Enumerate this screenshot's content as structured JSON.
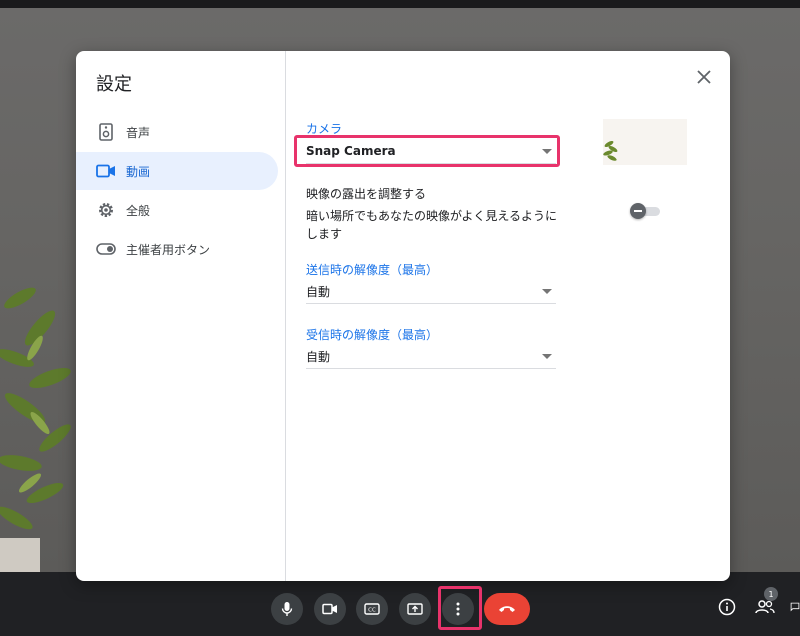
{
  "dialog": {
    "title": "設定",
    "nav": [
      {
        "label": "音声",
        "icon": "speaker-icon"
      },
      {
        "label": "動画",
        "icon": "videocam-icon"
      },
      {
        "label": "全般",
        "icon": "gear-icon"
      },
      {
        "label": "主催者用ボタン",
        "icon": "toggle-icon"
      }
    ],
    "active_nav": "動画",
    "camera": {
      "label": "カメラ",
      "value": "Snap Camera"
    },
    "exposure": {
      "title": "映像の露出を調整する",
      "description": "暗い場所でもあなたの映像がよく見えるようにします",
      "enabled": false
    },
    "send_resolution": {
      "label": "送信時の解像度（最高）",
      "value": "自動"
    },
    "receive_resolution": {
      "label": "受信時の解像度（最高）",
      "value": "自動"
    }
  },
  "toolbar": {
    "buttons": [
      "mic-icon",
      "videocam-icon",
      "closed-caption-icon",
      "present-screen-icon",
      "more-vert-icon",
      "call-end-icon"
    ],
    "right": [
      "info-icon",
      "people-icon",
      "chat-icon"
    ],
    "participant_count": "1"
  },
  "colors": {
    "accent": "#1a73e8",
    "highlight": "#e8336b",
    "end_call": "#ea4335"
  }
}
